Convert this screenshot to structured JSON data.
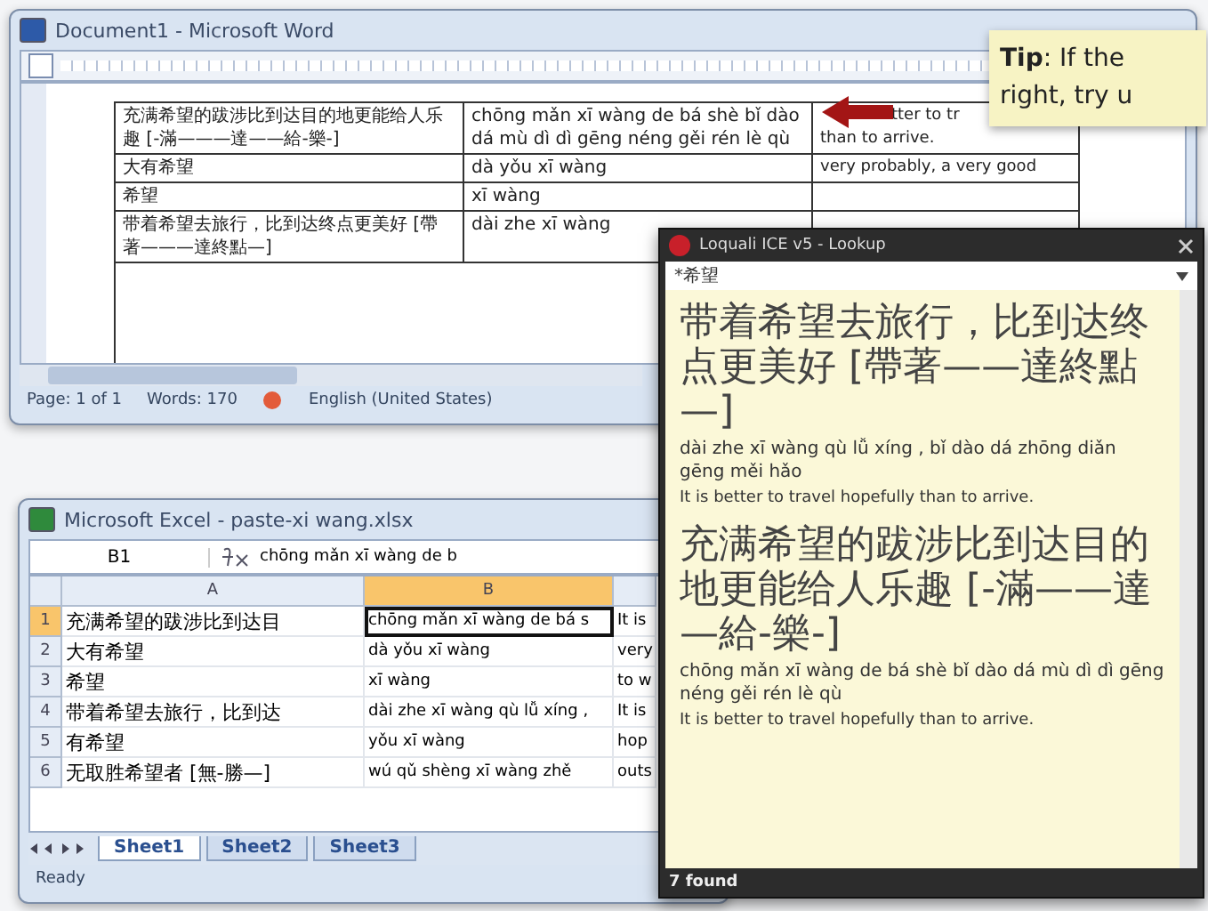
{
  "word_window": {
    "title": "Document1 - Microsoft Word",
    "table_rows": [
      {
        "hanzi": "充满希望的跋涉比到达目的地更能给人乐趣 [-滿———達——給-樂-]",
        "pinyin": "chōng mǎn xī wàng de bá shè bǐ dào dá mù dì dì gēng néng gěi rén lè qù",
        "english": [
          "tter to tr",
          "than to arrive."
        ]
      },
      {
        "hanzi": "大有希望",
        "pinyin": "dà yǒu xī wàng",
        "english": [
          "very probably, a very good"
        ]
      },
      {
        "hanzi": "希望",
        "pinyin": "xī wàng"
      },
      {
        "hanzi": "带着希望去旅行，比到达终点更美好 [帶著———達終點—]",
        "pinyin": "dài zhe xī wàng"
      }
    ],
    "status_bar": {
      "page": "Page: 1 of 1",
      "words": "Words: 170",
      "language": "English (United States)"
    }
  },
  "tip": {
    "text": "**Tip**: If the right, try u"
  },
  "excel_window": {
    "title": "Microsoft Excel - paste-xi wang.xlsx",
    "name_box": "B1",
    "formula": "chōng mǎn xī wàng de b",
    "columns": [
      {
        "label": "A",
        "selected": false
      },
      {
        "label": "B",
        "selected": true
      }
    ],
    "rows": [
      {
        "number": "1",
        "selected": true,
        "cells": [
          "充满希望的跋涉比到达目",
          "chōng mǎn xī wàng de bá s",
          "It is"
        ]
      },
      {
        "number": "2",
        "selected": false,
        "cells": [
          "大有希望",
          "dà yǒu xī wàng",
          "very"
        ]
      },
      {
        "number": "3",
        "selected": false,
        "cells": [
          "希望",
          "xī wàng",
          "to w"
        ]
      },
      {
        "number": "4",
        "selected": false,
        "cells": [
          "带着希望去旅行，比到达",
          "dài zhe xī wàng qù lǚ xíng ,",
          "It is"
        ]
      },
      {
        "number": "5",
        "selected": false,
        "cells": [
          "有希望",
          "yǒu xī wàng",
          "hop"
        ]
      },
      {
        "number": "6",
        "selected": false,
        "cells": [
          "无取胜希望者 [無-勝—]",
          "wú qǔ shèng xī wàng zhě",
          "outs"
        ]
      }
    ],
    "sheet_tabs": [
      {
        "label": "Sheet1",
        "selected": true
      },
      {
        "label": "Sheet2",
        "selected": false
      },
      {
        "label": "Sheet3",
        "selected": false
      }
    ],
    "status": "Ready"
  },
  "lookup": {
    "title": "Loquali ICE v5 - Lookup",
    "query": "*希望",
    "entries": [
      {
        "hanzi": "带着希望去旅行，比到达终点更美好 [帶著——達終點—]",
        "pinyin": "dài zhe xī wàng qù lǚ xíng , bǐ dào dá zhōng diǎn gēng měi hǎo",
        "english": "It is better to travel hopefully than to arrive."
      },
      {
        "hanzi": "充满希望的跋涉比到达目的地更能给人乐趣 [-滿——達—給-樂-]",
        "pinyin": "chōng mǎn xī wàng de bá shè bǐ dào dá mù dì dì gēng néng gěi rén lè qù",
        "english": "It is better to travel hopefully than to arrive."
      }
    ],
    "status": "7 found"
  }
}
